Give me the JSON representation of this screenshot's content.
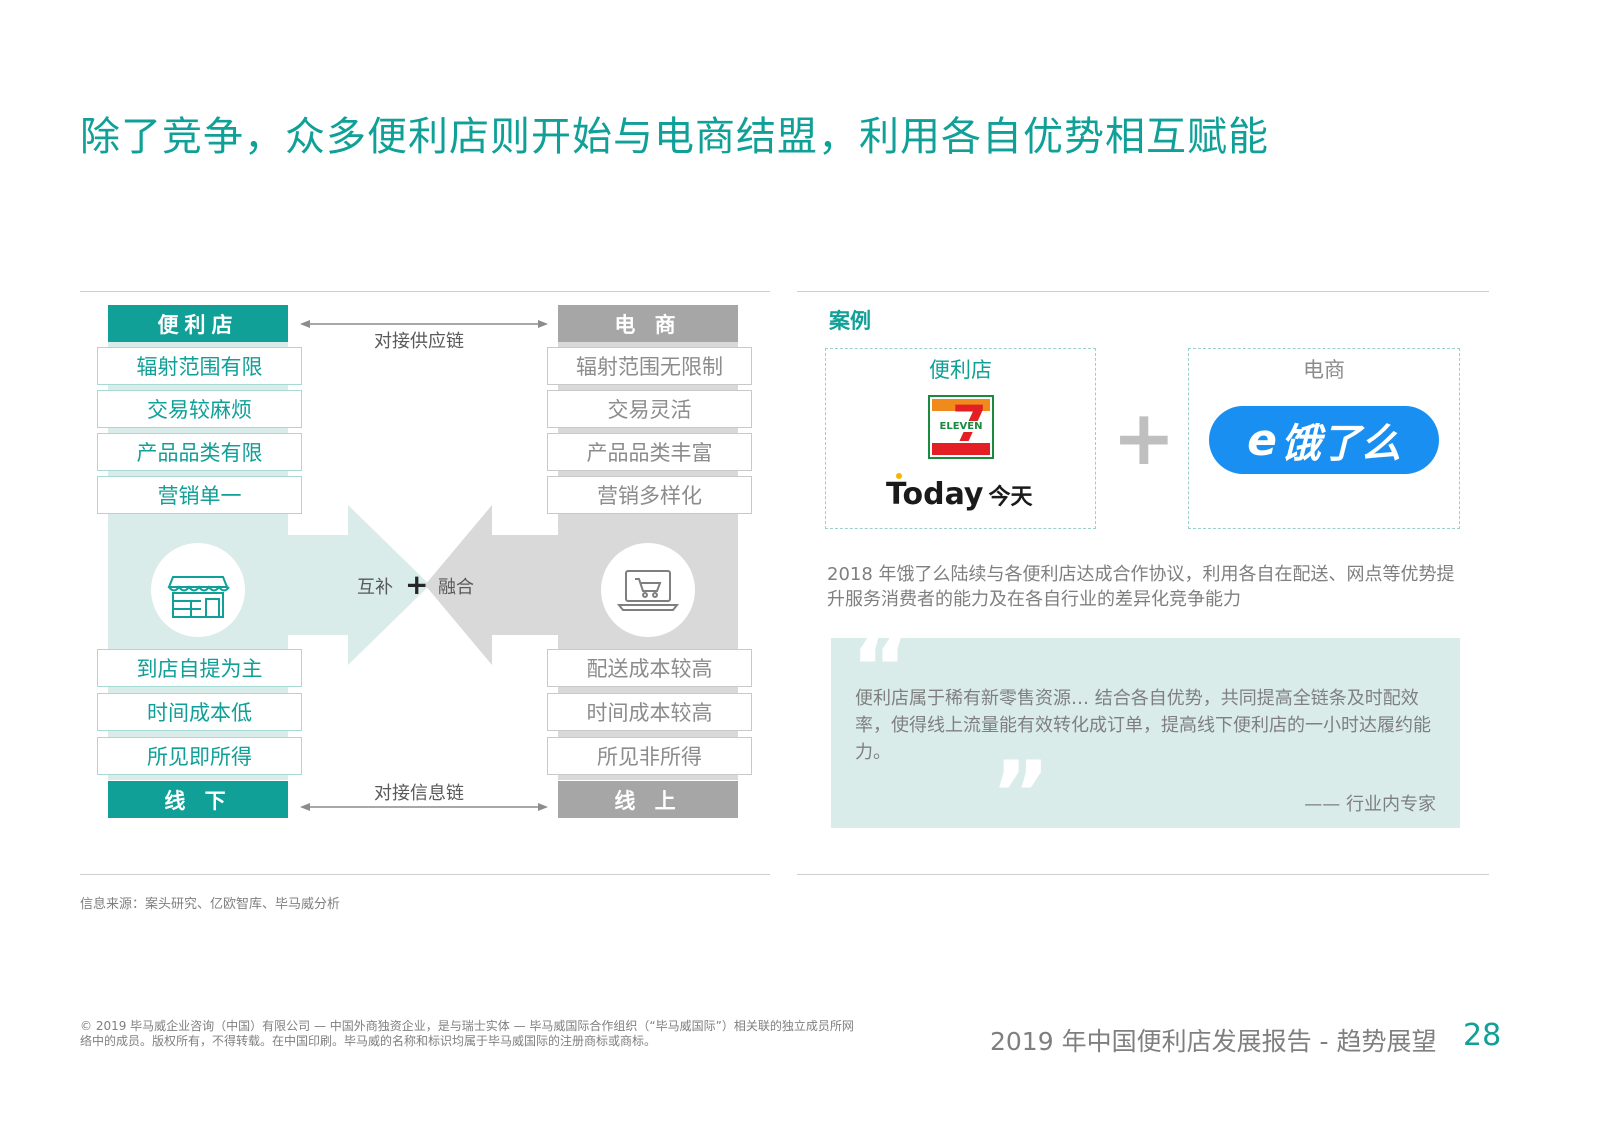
{
  "title": "除了竞争，众多便利店则开始与电商结盟，利用各自优势相互赋能",
  "left_panel": {
    "store_header": "便利店",
    "ecom_header": "电 商",
    "supply_chain": "对接供应链",
    "info_chain": "对接信息链",
    "store_top_items": [
      "辐射范围有限",
      "交易较麻烦",
      "产品品类有限",
      "营销单一"
    ],
    "ecom_top_items": [
      "辐射范围无限制",
      "交易灵活",
      "产品品类丰富",
      "营销多样化"
    ],
    "store_bottom_items": [
      "到店自提为主",
      "时间成本低",
      "所见即所得"
    ],
    "ecom_bottom_items": [
      "配送成本较高",
      "时间成本较高",
      "所见非所得"
    ],
    "complement": "互补",
    "plus": "+",
    "fusion": "融合",
    "offline": "线 下",
    "online": "线 上",
    "icons": {
      "store": "storefront-icon",
      "ecom": "laptop-cart-icon"
    },
    "colors": {
      "teal": "#10a098",
      "teal_light": "#d9ecea",
      "grey": "#a6a6a6",
      "grey_light": "#d9d9d9"
    }
  },
  "case": {
    "heading": "案例",
    "store_label": "便利店",
    "ecom_label": "电商",
    "seven_eleven_logo_text": "ELEVEN",
    "today_logo_text": "Today",
    "today_logo_cn": "今天",
    "eleme_logo_text": "饿了么",
    "plus_sign": "+",
    "description": "2018 年饿了么陆续与各便利店达成合作协议，利用各自在配送、网点等优势提升服务消费者的能力及在各自行业的差异化竞争能力",
    "quote_open": "“",
    "quote_close": "”",
    "quote": "便利店属于稀有新零售资源… 结合各自优势，共同提高全链条及时配效率，使得线上流量能有效转化成订单，提高线下便利店的一小时达履约能力。",
    "attribution": "—— 行业内专家"
  },
  "source": "信息来源：案头研究、亿欧智库、毕马威分析",
  "copyright": "© 2019 毕马威企业咨询（中国）有限公司 — 中国外商独资企业，是与瑞士实体 — 毕马威国际合作组织（“毕马威国际”）相关联的独立成员所网络中的成员。版权所有，不得转载。在中国印刷。毕马威的名称和标识均属于毕马威国际的注册商标或商标。",
  "footer_title": "2019 年中国便利店发展报告 - 趋势展望",
  "page_number": "28"
}
